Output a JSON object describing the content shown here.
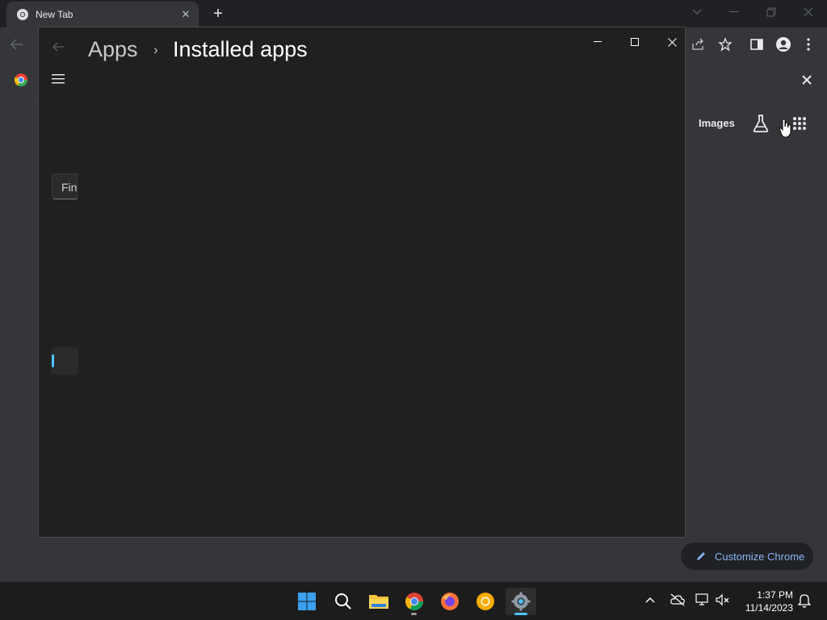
{
  "chrome": {
    "tab_title": "New Tab",
    "images_link": "Images",
    "customize_label": "Customize Chrome"
  },
  "settings": {
    "breadcrumb_parent": "Apps",
    "breadcrumb_separator": "›",
    "breadcrumb_current": "Installed apps",
    "search_placeholder": "Find"
  },
  "taskbar": {
    "apps": [
      "start-icon",
      "search-icon",
      "file-explorer-icon",
      "chrome-icon",
      "firefox-icon",
      "chrome-canary-icon",
      "settings-icon"
    ],
    "time": "1:37 PM",
    "date": "11/14/2023"
  },
  "colors": {
    "accent": "#4cc2ff",
    "link": "#8ab4f8"
  }
}
